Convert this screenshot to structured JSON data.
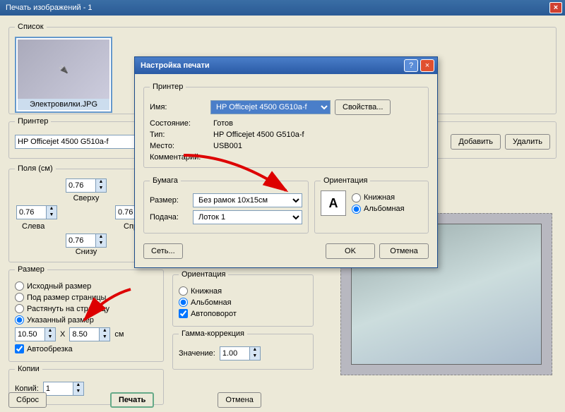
{
  "window": {
    "title": "Печать изображений - 1"
  },
  "list": {
    "legend": "Список",
    "thumb_name": "Электровилки.JPG"
  },
  "printer": {
    "legend": "Принтер",
    "name": "HP Officejet 4500 G510a-f",
    "add": "Добавить",
    "del": "Удалить"
  },
  "margins": {
    "legend": "Поля (см)",
    "top_label": "Сверху",
    "top": "0.76",
    "left_label": "Слева",
    "left": "0.76",
    "right_label": "Справа",
    "right": "0.76",
    "bottom_label": "Снизу",
    "bottom": "0.76"
  },
  "size": {
    "legend": "Размер",
    "orig": "Исходный размер",
    "fit": "Под размер страницы",
    "stretch": "Растянуть на страницу",
    "custom": "Указанный размер",
    "w": "10.50",
    "x": "X",
    "h": "8.50",
    "unit": "см",
    "autocrop": "Автообрезка"
  },
  "copies": {
    "legend": "Копии",
    "label": "Копий:",
    "val": "1"
  },
  "orient": {
    "legend": "Ориентация",
    "portrait": "Книжная",
    "landscape": "Альбомная",
    "autorotate": "Автоповорот"
  },
  "gamma": {
    "legend": "Гамма-коррекция",
    "label": "Значение:",
    "val": "1.00"
  },
  "buttons": {
    "reset": "Сброс",
    "print": "Печать",
    "cancel": "Отмена"
  },
  "modal": {
    "title": "Настройка печати",
    "printer_legend": "Принтер",
    "name_label": "Имя:",
    "name": "HP Officejet 4500 G510a-f",
    "props": "Свойства...",
    "state_label": "Состояние:",
    "state": "Готов",
    "type_label": "Тип:",
    "type": "HP Officejet 4500 G510a-f",
    "place_label": "Место:",
    "place": "USB001",
    "comment_label": "Комментарий:",
    "paper_legend": "Бумага",
    "size_label": "Размер:",
    "size": "Без рамок 10x15см",
    "feed_label": "Подача:",
    "feed": "Лоток 1",
    "orient_legend": "Ориентация",
    "portrait": "Книжная",
    "landscape": "Альбомная",
    "net": "Сеть...",
    "ok": "OK",
    "cancel": "Отмена"
  }
}
